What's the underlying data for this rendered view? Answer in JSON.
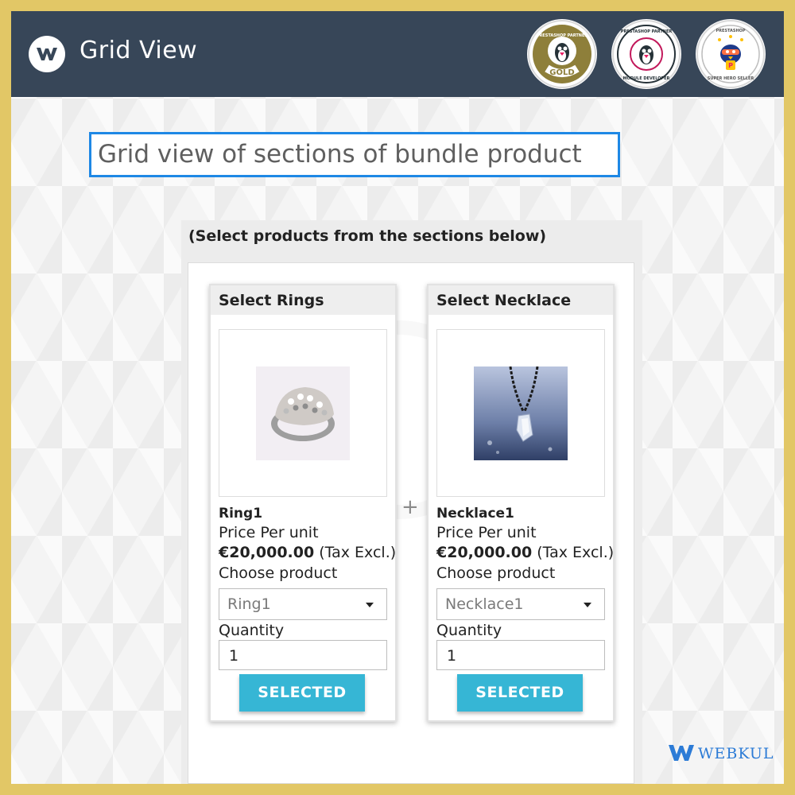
{
  "header": {
    "title": "Grid View",
    "logo_icon": "webkul-w-logo-icon",
    "badges": [
      {
        "name": "prestashop-partner-gold-badge",
        "top_text": "PRESTASHOP PARTNER",
        "bottom_text": "GOLD",
        "color": "#8e7f3a"
      },
      {
        "name": "prestashop-partner-module-developer-badge",
        "top_text": "PRESTASHOP PARTNER",
        "bottom_text": "MODULE DEVELOPER",
        "color": "#c2185b"
      },
      {
        "name": "prestashop-super-hero-seller-badge",
        "top_text": "PRESTASHOP",
        "bottom_text": "SUPER HERO SELLER",
        "color": "#1e3a8a"
      }
    ]
  },
  "caption": "Grid view of sections of bundle product",
  "panel": {
    "instruction": "(Select products from the sections below)",
    "sections": [
      {
        "title": "Select Rings",
        "product_name": "Ring1",
        "price_label": "Price Per unit",
        "price": "€20,000.00",
        "tax_note": "(Tax Excl.)",
        "choose_label": "Choose product",
        "selected_option": "Ring1",
        "quantity_label": "Quantity",
        "quantity": "1",
        "button_label": "SELECTED"
      },
      {
        "title": "Select Necklace",
        "product_name": "Necklace1",
        "price_label": "Price Per unit",
        "price": "€20,000.00",
        "tax_note": "(Tax Excl.)",
        "choose_label": "Choose product",
        "selected_option": "Necklace1",
        "quantity_label": "Quantity",
        "quantity": "1",
        "button_label": "SELECTED"
      }
    ],
    "separator": "+"
  },
  "brand": {
    "name": "WEBKUL",
    "color": "#2c7bd6"
  },
  "colors": {
    "frame_border": "#e2c766",
    "header_bg": "#374658",
    "caption_border": "#1e88e5",
    "button_bg": "#36b6d5"
  }
}
